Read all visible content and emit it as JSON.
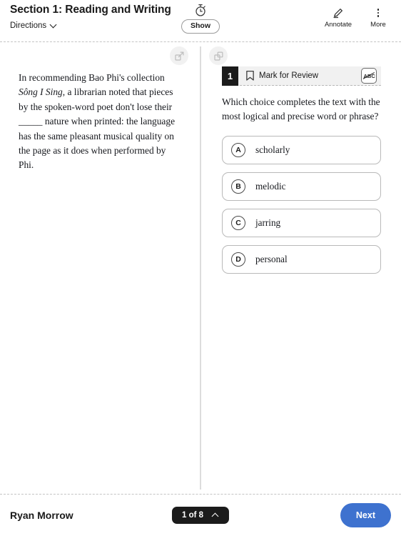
{
  "header": {
    "section_title": "Section 1: Reading and Writing",
    "directions_label": "Directions",
    "timer_icon": "stopwatch-icon",
    "show_label": "Show",
    "annotate_label": "Annotate",
    "annotate_icon": "pencil-icon",
    "more_label": "More",
    "more_icon": "vertical-dots-icon"
  },
  "passage": {
    "expand_icon": "expand-out-icon",
    "text_part1": "In recommending Bao Phi's collection ",
    "title_italic": "Sông I Sing",
    "text_part2": ", a librarian noted that pieces by the spoken-word poet don't lose their _____ nature when printed: the language has the same pleasant musical quality on the page as it does when performed by Phi."
  },
  "question": {
    "collapse_icon": "expand-in-icon",
    "number": "1",
    "bookmark_icon": "bookmark-icon",
    "mark_for_review_label": "Mark for Review",
    "abc_icon": "abc-strikethrough-icon",
    "stem": "Which choice completes the text with the most logical and precise word or phrase?",
    "choices": [
      {
        "letter": "A",
        "text": "scholarly"
      },
      {
        "letter": "B",
        "text": "melodic"
      },
      {
        "letter": "C",
        "text": "jarring"
      },
      {
        "letter": "D",
        "text": "personal"
      }
    ]
  },
  "footer": {
    "user_name": "Ryan Morrow",
    "page_indicator": "1 of 8",
    "next_label": "Next"
  },
  "colors": {
    "accent_blue": "#3e72cf",
    "badge_black": "#1b1b1b",
    "bar_gray": "#f1f1f1",
    "divider_gray": "#dcdcdc"
  }
}
